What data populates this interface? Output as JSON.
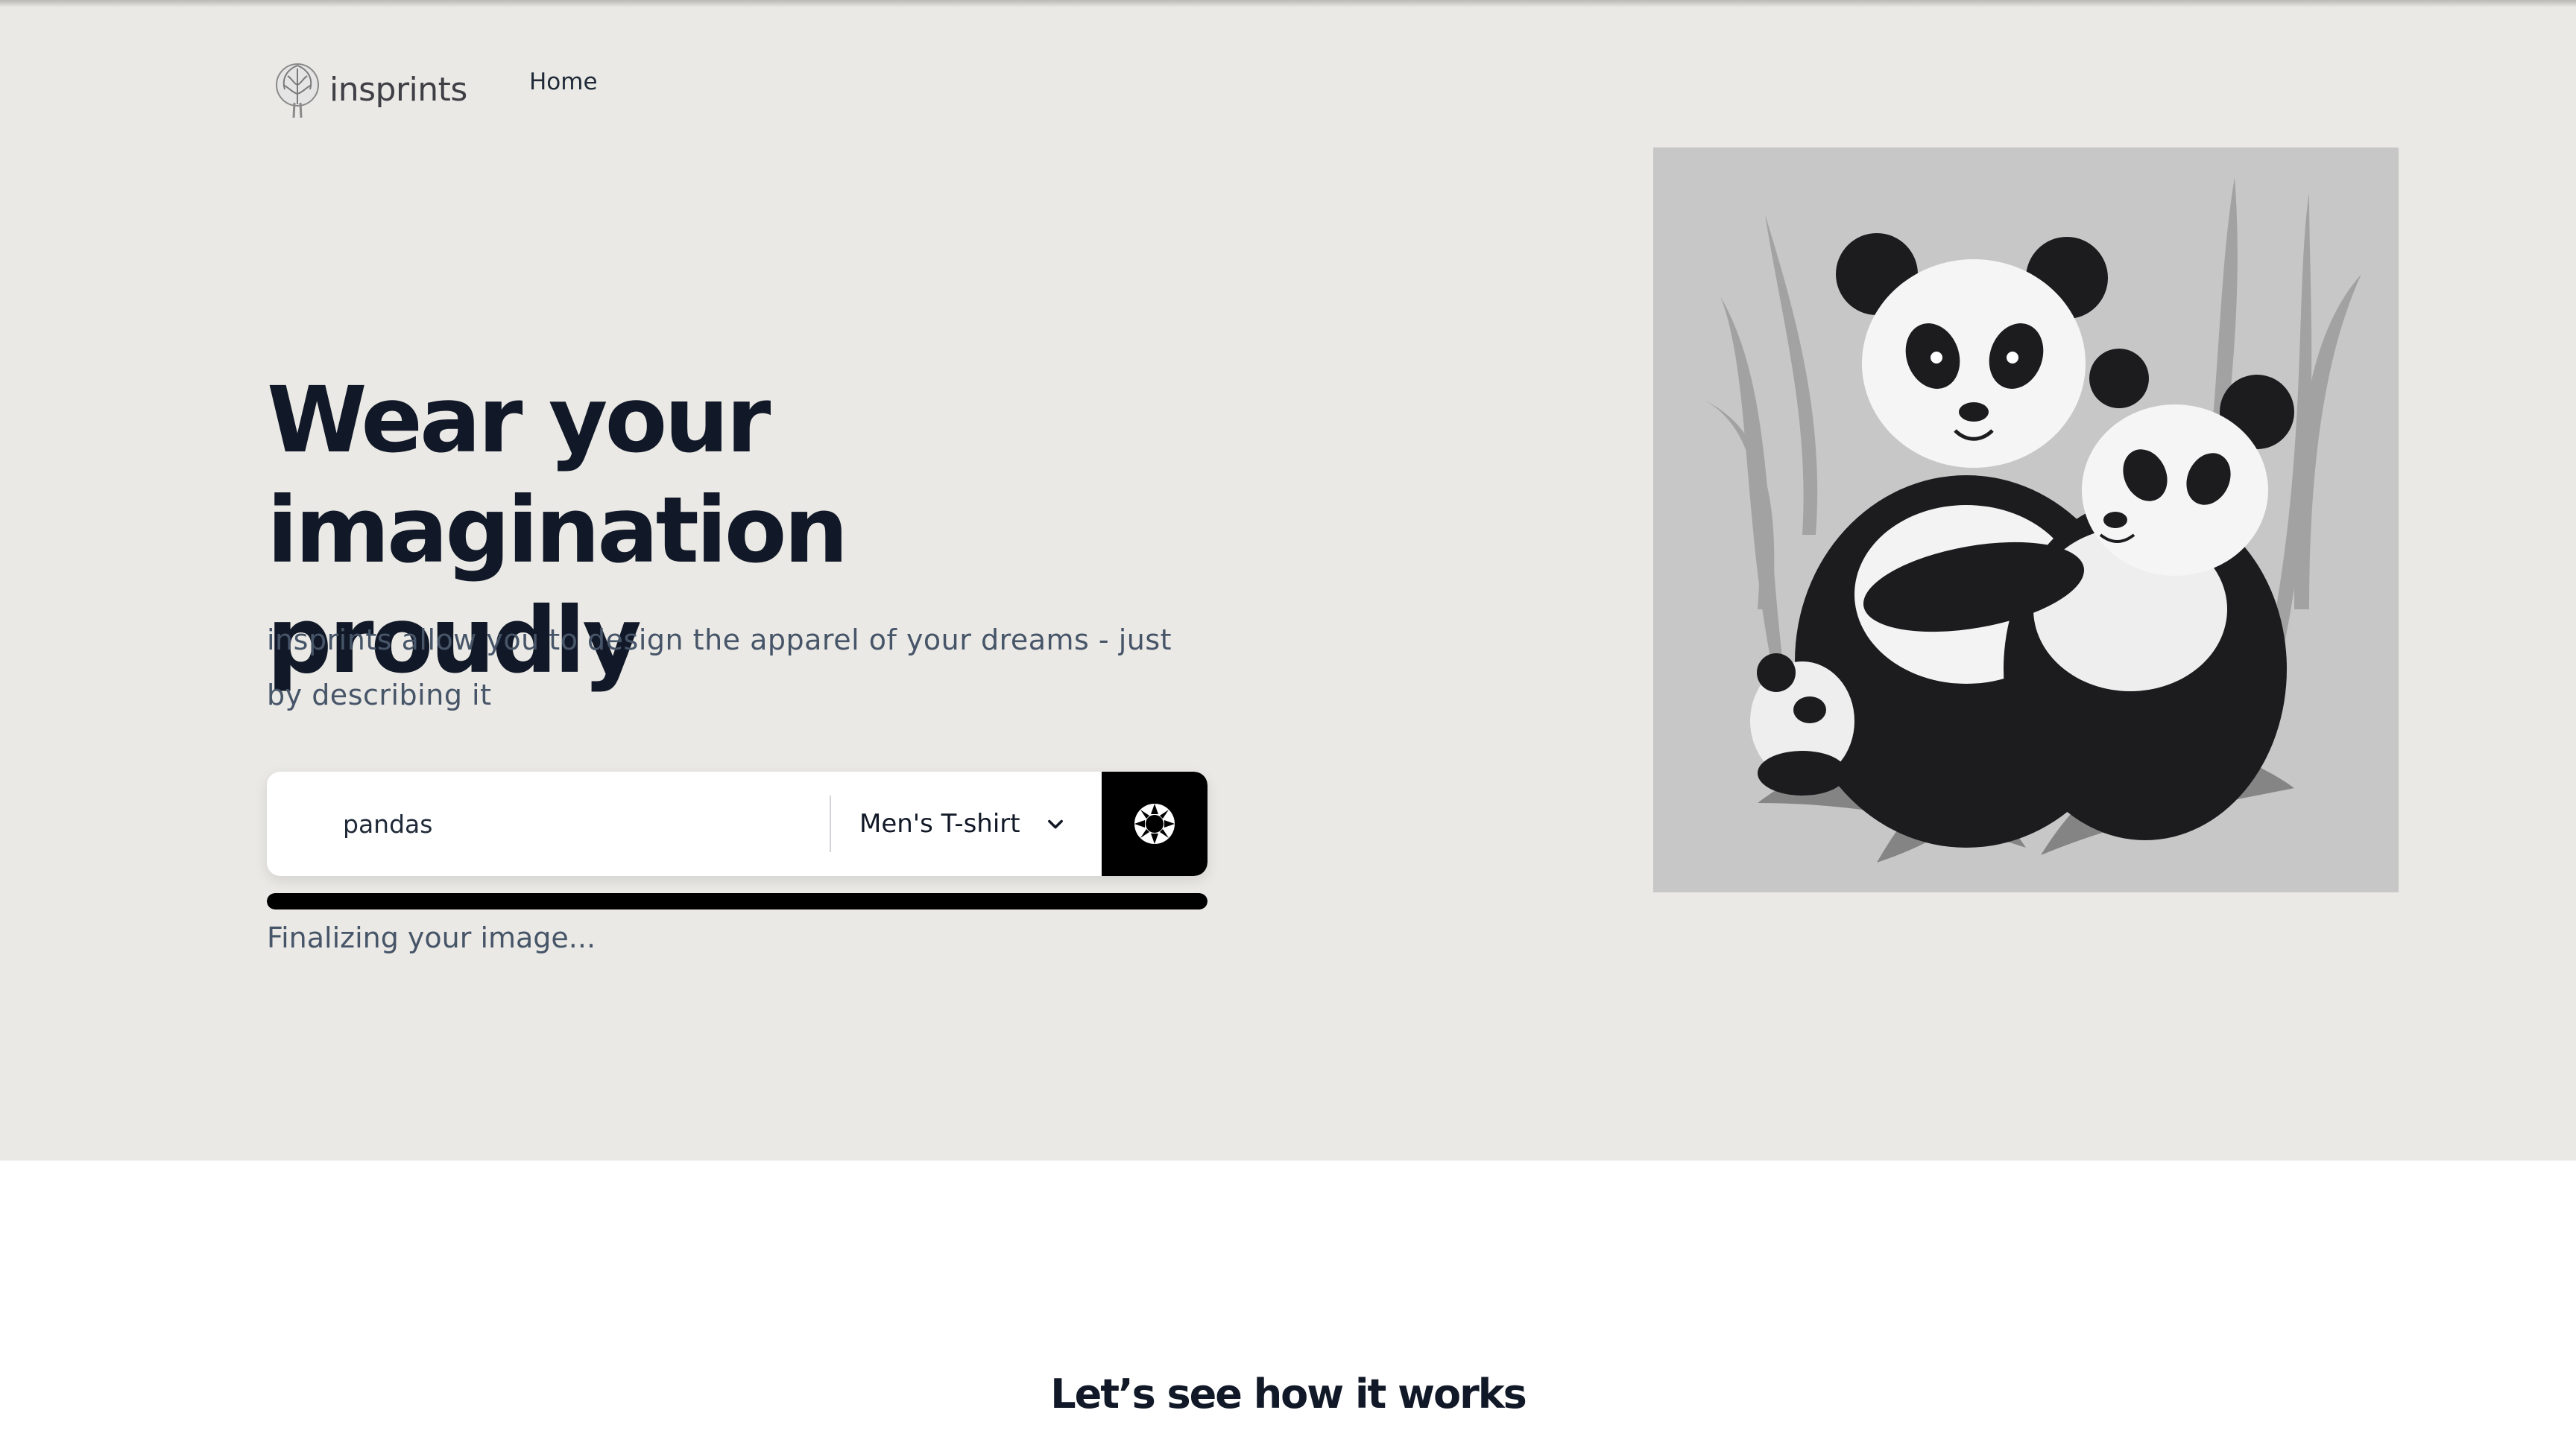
{
  "brand": {
    "name": "insprints"
  },
  "nav": {
    "home_label": "Home"
  },
  "hero": {
    "headline": "Wear your imagination proudly",
    "subtext": "insprints allow you to design the apparel of your dreams - just by describing it"
  },
  "prompt": {
    "value": "pandas",
    "product_selected": "Men's T-shirt"
  },
  "generation": {
    "status": "Finalizing your image...",
    "progress": 1.0
  },
  "preview": {
    "subject": "pandas"
  },
  "how_it_works": {
    "title": "Let’s see how it works"
  },
  "colors": {
    "hero_background": "#eae9e5",
    "text_primary": "#111827",
    "text_secondary": "#475569",
    "button": "#000000"
  },
  "icons": [
    "brain-tree-logo-icon",
    "chevron-down-icon",
    "spinner-icon"
  ]
}
